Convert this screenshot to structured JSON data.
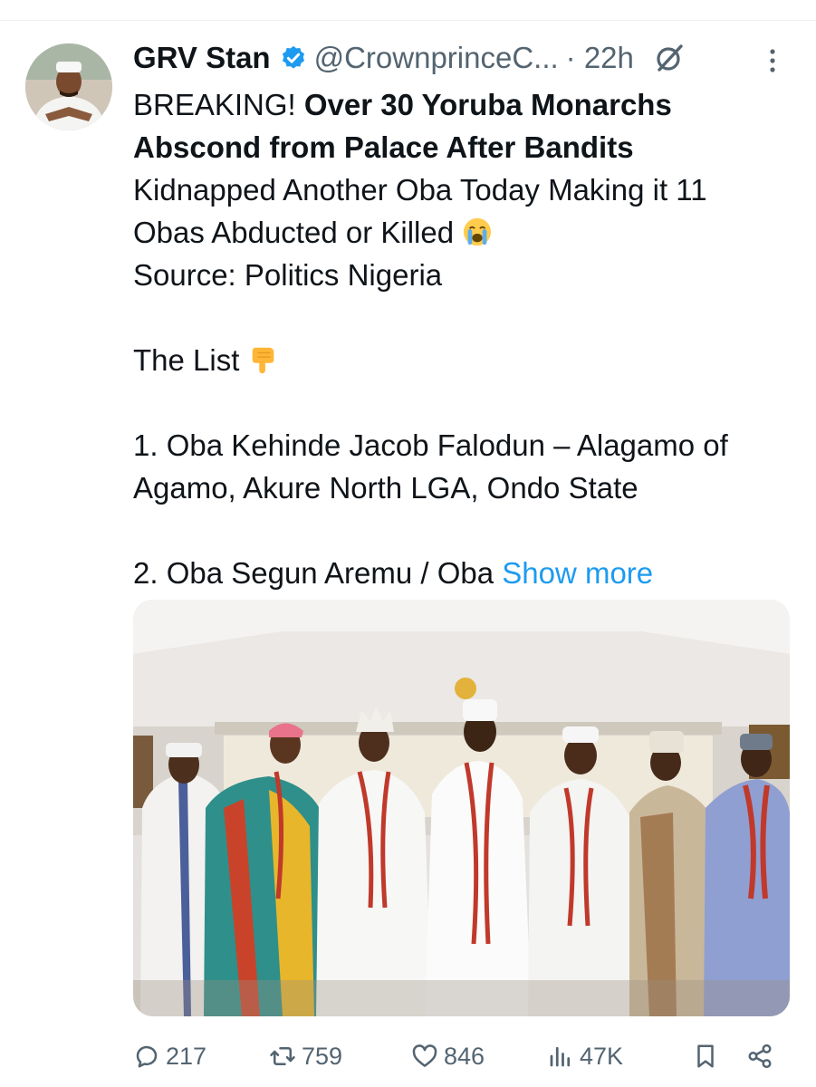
{
  "tweet": {
    "author_name": "GRV Stan",
    "handle": "@CrownprinceC...",
    "time": "· 22h",
    "headline_prefix": "BREAKING! ",
    "headline_bold_1": "Over 30 Yoruba Monarchs",
    "headline_bold_2": "Abscond from Palace After Bandits",
    "line_3": "Kidnapped Another Oba Today Making it 11",
    "line_4": "Obas Abducted or Killed",
    "line_5": "Source: Politics Nigeria",
    "list_intro": "The List",
    "item_1_line_1": "1. Oba Kehinde Jacob Falodun – Alagamo of",
    "item_1_line_2": "Agamo, Akure North LGA, Ondo State",
    "item_2": "2. Oba Segun Aremu / Oba ",
    "show_more": "Show more"
  },
  "icons": {
    "verified": "verified-badge-icon",
    "grok": "grok-icon",
    "more": "more-vertical-icon",
    "crying": "loudly-crying-face-emoji",
    "pointing": "backhand-index-pointing-down-emoji"
  },
  "stats": {
    "replies": "217",
    "reposts": "759",
    "likes": "846",
    "views": "47K"
  },
  "colors": {
    "link": "#1d9bf0",
    "secondary_text": "#536471",
    "primary_text": "#0f1419"
  }
}
